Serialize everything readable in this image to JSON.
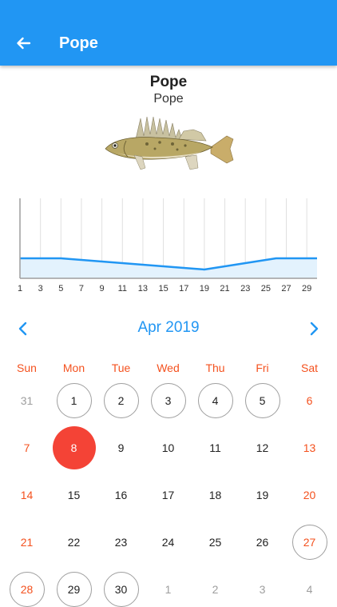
{
  "app_bar": {
    "title": "Pope"
  },
  "species": {
    "name": "Pope",
    "subtitle": "Pope"
  },
  "chart_data": {
    "type": "area",
    "x": [
      1,
      2,
      3,
      4,
      5,
      6,
      7,
      8,
      9,
      10,
      11,
      12,
      13,
      14,
      15,
      16,
      17,
      18,
      19,
      20,
      21,
      22,
      23,
      24,
      25,
      26,
      27,
      28,
      29,
      30
    ],
    "values": [
      0.25,
      0.25,
      0.25,
      0.25,
      0.25,
      0.24,
      0.23,
      0.22,
      0.21,
      0.2,
      0.19,
      0.18,
      0.17,
      0.16,
      0.15,
      0.14,
      0.13,
      0.12,
      0.11,
      0.13,
      0.15,
      0.17,
      0.19,
      0.21,
      0.23,
      0.25,
      0.25,
      0.25,
      0.25,
      0.25
    ],
    "xticks": [
      "1",
      "3",
      "5",
      "7",
      "9",
      "11",
      "13",
      "15",
      "17",
      "19",
      "21",
      "23",
      "25",
      "27",
      "29"
    ],
    "ylim": [
      0,
      1
    ],
    "grid": true,
    "line_color": "#2196F3",
    "fill_color": "#E3F2FD"
  },
  "calendar": {
    "month_label": "Apr 2019",
    "prev_icon": "chevron-left-icon",
    "next_icon": "chevron-right-icon",
    "weekdays": [
      "Sun",
      "Mon",
      "Tue",
      "Wed",
      "Thu",
      "Fri",
      "Sat"
    ],
    "weeks": [
      [
        {
          "d": "31",
          "other": true
        },
        {
          "d": "1",
          "outlined": true
        },
        {
          "d": "2",
          "outlined": true
        },
        {
          "d": "3",
          "outlined": true
        },
        {
          "d": "4",
          "outlined": true
        },
        {
          "d": "5",
          "outlined": true
        },
        {
          "d": "6"
        }
      ],
      [
        {
          "d": "7"
        },
        {
          "d": "8",
          "selected": true
        },
        {
          "d": "9"
        },
        {
          "d": "10"
        },
        {
          "d": "11"
        },
        {
          "d": "12"
        },
        {
          "d": "13"
        }
      ],
      [
        {
          "d": "14"
        },
        {
          "d": "15"
        },
        {
          "d": "16"
        },
        {
          "d": "17"
        },
        {
          "d": "18"
        },
        {
          "d": "19"
        },
        {
          "d": "20"
        }
      ],
      [
        {
          "d": "21"
        },
        {
          "d": "22"
        },
        {
          "d": "23"
        },
        {
          "d": "24"
        },
        {
          "d": "25"
        },
        {
          "d": "26"
        },
        {
          "d": "27",
          "outlined": true
        }
      ],
      [
        {
          "d": "28",
          "outlined": true
        },
        {
          "d": "29",
          "outlined": true
        },
        {
          "d": "30",
          "outlined": true
        },
        {
          "d": "1",
          "other": true
        },
        {
          "d": "2",
          "other": true
        },
        {
          "d": "3",
          "other": true
        },
        {
          "d": "4",
          "other": true
        }
      ]
    ]
  },
  "colors": {
    "primary": "#2196F3",
    "weekend": "#F4511E",
    "selected": "#F44336"
  }
}
